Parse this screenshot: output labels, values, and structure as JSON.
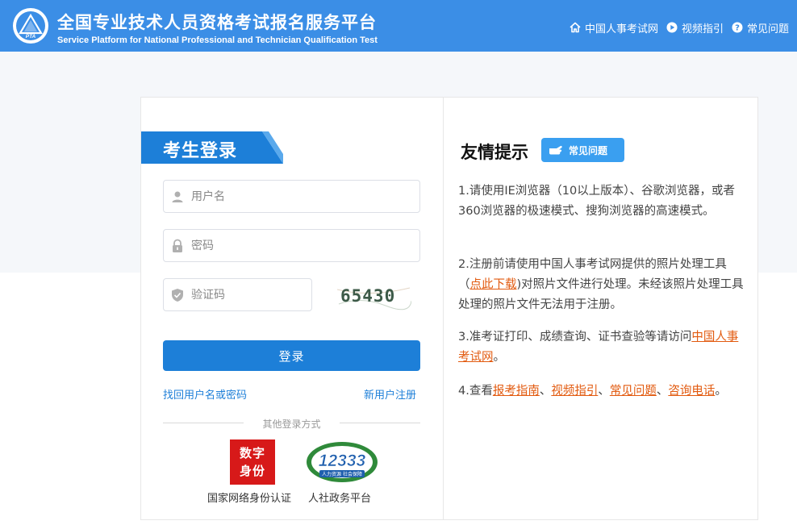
{
  "header": {
    "title": "全国专业技术人员资格考试报名服务平台",
    "subtitle": "Service Platform for National Professional and Technician Qualification Test",
    "logo_text": "PTA",
    "nav": [
      {
        "label": "中国人事考试网",
        "icon": "home-icon"
      },
      {
        "label": "视频指引",
        "icon": "play-icon"
      },
      {
        "label": "常见问题",
        "icon": "question-icon"
      }
    ]
  },
  "login": {
    "title": "考生登录",
    "username_placeholder": "用户名",
    "password_placeholder": "密码",
    "captcha_placeholder": "验证码",
    "captcha_text": "65430",
    "submit_label": "登录",
    "forgot_label": "找回用户名或密码",
    "register_label": "新用户注册",
    "other_label": "其他登录方式",
    "alt_methods": [
      {
        "label": "国家网络身份认证",
        "badge_line1": "数字",
        "badge_line2": "身份"
      },
      {
        "label": "人社政务平台",
        "badge_text": "12333",
        "badge_sub": "人力资源 社会保障"
      }
    ]
  },
  "tips": {
    "title": "友情提示",
    "faq_badge": "常见问题",
    "t1": "1.请使用IE浏览器（10以上版本）、谷歌浏览器，或者360浏览器的极速模式、搜狗浏览器的高速模式。",
    "t2_a": "2.注册前请使用中国人事考试网提供的照片处理工具（",
    "t2_link": "点此下载",
    "t2_b": ")对照片文件进行处理。未经该照片处理工具处理的照片文件无法用于注册。",
    "t3_a": "3.准考证打印、成绩查询、证书查验等请访问",
    "t3_link": "中国人事考试网",
    "t3_b": "。",
    "t4_a": "4.查看",
    "t4_link1": "报考指南",
    "t4_sep1": "、",
    "t4_link2": "视频指引",
    "t4_sep2": "、",
    "t4_link3": "常见问题",
    "t4_sep3": "、",
    "t4_link4": "咨询电话",
    "t4_b": "。"
  },
  "colors": {
    "header": "#3b8ee6",
    "primary": "#1d7fd8",
    "link_orange": "#e25a0f",
    "badge_red": "#d71919"
  }
}
